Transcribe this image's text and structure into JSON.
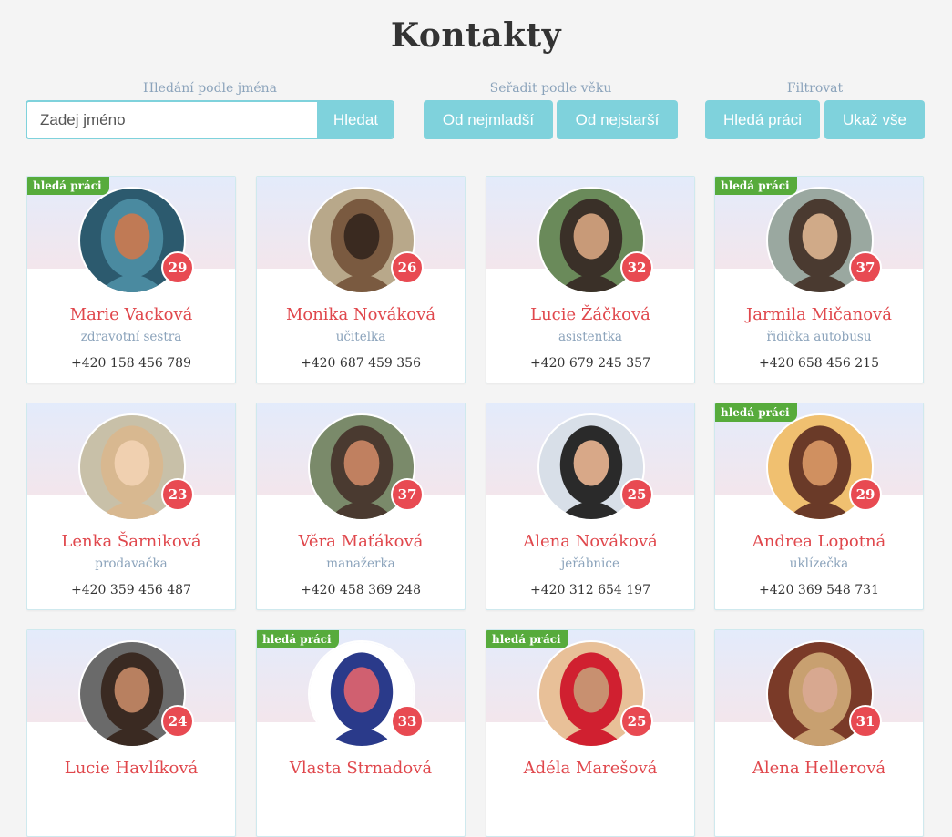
{
  "page": {
    "title": "Kontakty"
  },
  "controls": {
    "search_label": "Hledání podle jména",
    "search_placeholder": "Zadej jméno",
    "search_button": "Hledat",
    "sort_label": "Seřadit podle věku",
    "sort_youngest": "Od nejmladší",
    "sort_oldest": "Od nejstarší",
    "filter_label": "Filtrovat",
    "filter_seeking": "Hledá práci",
    "filter_all": "Ukaž vše"
  },
  "badge_text": "hledá práci",
  "colors": {
    "accent": "#7fd2dc",
    "name": "#e0474c",
    "age_badge": "#e84a52",
    "seeking_badge": "#57ab3c"
  },
  "contacts": [
    {
      "name": "Marie Vacková",
      "job": "zdravotní sestra",
      "phone": "+420 158 456 789",
      "age": "29",
      "seeking": true
    },
    {
      "name": "Monika Nováková",
      "job": "učitelka",
      "phone": "+420 687 459 356",
      "age": "26",
      "seeking": false
    },
    {
      "name": "Lucie Žáčková",
      "job": "asistentka",
      "phone": "+420 679 245 357",
      "age": "32",
      "seeking": false
    },
    {
      "name": "Jarmila Mičanová",
      "job": "řidička autobusu",
      "phone": "+420 658 456 215",
      "age": "37",
      "seeking": true
    },
    {
      "name": "Lenka Šarniková",
      "job": "prodavačka",
      "phone": "+420 359 456 487",
      "age": "23",
      "seeking": false
    },
    {
      "name": "Věra Maťáková",
      "job": "manažerka",
      "phone": "+420 458 369 248",
      "age": "37",
      "seeking": false
    },
    {
      "name": "Alena Nováková",
      "job": "jeřábnice",
      "phone": "+420 312 654 197",
      "age": "25",
      "seeking": false
    },
    {
      "name": "Andrea Lopotná",
      "job": "uklízečka",
      "phone": "+420 369 548 731",
      "age": "29",
      "seeking": true
    },
    {
      "name": "Lucie Havlíková",
      "job": "",
      "phone": "",
      "age": "24",
      "seeking": false
    },
    {
      "name": "Vlasta Strnadová",
      "job": "",
      "phone": "",
      "age": "33",
      "seeking": true
    },
    {
      "name": "Adéla Marešová",
      "job": "",
      "phone": "",
      "age": "25",
      "seeking": true
    },
    {
      "name": "Alena Hellerová",
      "job": "",
      "phone": "",
      "age": "31",
      "seeking": false
    }
  ]
}
